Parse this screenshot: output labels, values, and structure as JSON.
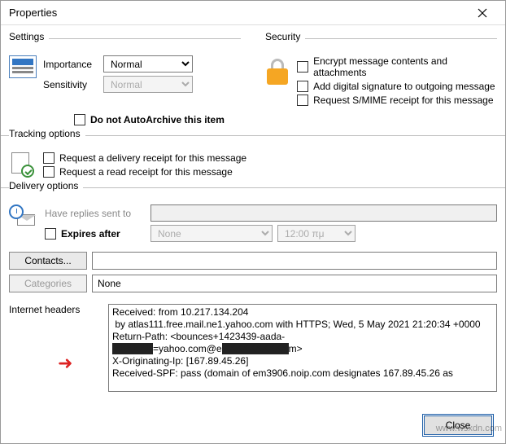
{
  "window": {
    "title": "Properties"
  },
  "settings": {
    "legend": "Settings",
    "importance_label": "Importance",
    "importance_value": "Normal",
    "sensitivity_label": "Sensitivity",
    "sensitivity_value": "Normal",
    "autoarchive_label": "Do not AutoArchive this item"
  },
  "security": {
    "legend": "Security",
    "encrypt_label": "Encrypt message contents and attachments",
    "sign_label": "Add digital signature to outgoing message",
    "smime_label": "Request S/MIME receipt for this message"
  },
  "tracking": {
    "legend": "Tracking options",
    "delivery_receipt_label": "Request a delivery receipt for this message",
    "read_receipt_label": "Request a read receipt for this message"
  },
  "delivery": {
    "legend": "Delivery options",
    "replies_label": "Have replies sent to",
    "expires_label": "Expires after",
    "expires_date_value": "None",
    "expires_time_value": "12:00 πμ"
  },
  "buttons": {
    "contacts": "Contacts...",
    "categories": "Categories",
    "categories_value": "None",
    "close": "Close"
  },
  "headers": {
    "label": "Internet headers",
    "text_line1": "Received: from 10.217.134.204",
    "text_line2": " by atlas111.free.mail.ne1.yahoo.com with HTTPS; Wed, 5 May 2021 21:20:34 +0000",
    "text_line3": "Return-Path: <bounces+1423439-aada-",
    "text_line4_suffix": "=yahoo.com@e",
    "text_line4_end": "m>",
    "text_line5": "X-Originating-Ip: [167.89.45.26]",
    "text_line6": "Received-SPF: pass (domain of em3906.noip.com designates 167.89.45.26 as"
  },
  "watermark": "www.wsxdn.com"
}
